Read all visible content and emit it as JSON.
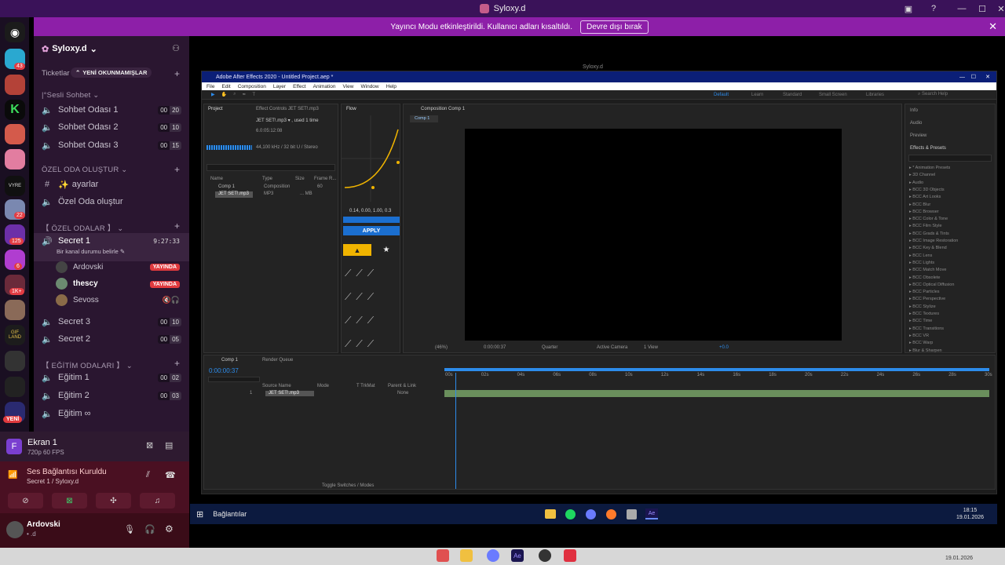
{
  "window": {
    "title": "Syloxy.d"
  },
  "notice": {
    "text": "Yayıncı Modu etkinleştirildi. Kullanıcı adları kısaltıldı.",
    "button": "Devre dışı bırak"
  },
  "rail": {
    "badges": [
      "43",
      "22",
      "125",
      "6",
      "1K+",
      "1"
    ],
    "new_label": "YENİ",
    "gif_label": "GIF LAND"
  },
  "server": {
    "name": "Syloxy.d",
    "chevron": "⌄"
  },
  "channels": {
    "ticketlar": "Ticketlar",
    "new_unread": "YENİ OKUNMAMIŞLAR",
    "cat_voice": "|°Sesli Sohbet",
    "voice": [
      {
        "name": "Sohbet Odası 1",
        "a": "00",
        "b": "20"
      },
      {
        "name": "Sohbet Odası 2",
        "a": "00",
        "b": "10"
      },
      {
        "name": "Sohbet Odası 3",
        "a": "00",
        "b": "15"
      }
    ],
    "cat_private_create": "ÖZEL ODA OLUŞTUR",
    "settings": "ayarlar",
    "create_room": "Özel Oda oluştur",
    "cat_private_rooms": "【 ÖZEL ODALAR 】",
    "secret1": "Secret 1",
    "secret1_time": "9:27:33",
    "status_prompt": "Bir kanal durumu belirle",
    "users": [
      {
        "name": "Ardovski",
        "badge": "YAYINDA"
      },
      {
        "name": "thescy",
        "badge": "YAYINDA"
      },
      {
        "name": "Sevoss",
        "badge": ""
      }
    ],
    "secret3": {
      "name": "Secret 3",
      "a": "00",
      "b": "10"
    },
    "secret2": {
      "name": "Secret 2",
      "a": "00",
      "b": "05"
    },
    "cat_education": "【 EĞİTİM ODALARI 】",
    "edu": [
      {
        "name": "Eğitim 1",
        "a": "00",
        "b": "02"
      },
      {
        "name": "Eğitim 2",
        "a": "00",
        "b": "03"
      },
      {
        "name": "Eğitim ∞",
        "a": "",
        "b": ""
      }
    ]
  },
  "stream": {
    "title": "Ekran 1",
    "sub": "720p 60 FPS"
  },
  "voice_status": {
    "title": "Ses Bağlantısı Kuruldu",
    "sub": "Secret 1 / Syloxy.d"
  },
  "self": {
    "name": "Ardovski",
    "status": "• .d"
  },
  "shared": {
    "owner": "Syloxy.d"
  },
  "ae": {
    "title": "Adobe After Effects 2020 - Untitled Project.aep *",
    "menu": [
      "File",
      "Edit",
      "Composition",
      "Layer",
      "Effect",
      "Animation",
      "View",
      "Window",
      "Help"
    ],
    "workspaces": [
      "Default",
      "Learn",
      "Standard",
      "Small Screen",
      "Libraries"
    ],
    "search": "Search Help",
    "project_tab": "Project",
    "effect_controls": "Effect Controls JET SET!.mp3",
    "file_info": [
      "JET SET!.mp3 ▾ , used 1 time",
      "6.0:05:12:08",
      "44,100 kHz / 32 bit U / Stereo"
    ],
    "project_cols": [
      "Name",
      "Type",
      "Size",
      "Frame R..."
    ],
    "project_rows": [
      {
        "name": "Comp 1",
        "type": "Composition",
        "size": "",
        "fr": "60"
      },
      {
        "name": "JET SET!.mp3",
        "type": "MP3",
        "size": "... MB",
        "fr": ""
      }
    ],
    "flow_tab": "Flow",
    "apply": "APPLY",
    "flow_values": "0.14, 0.00, 1.00, 0.3",
    "comp_tab": "Composition Comp 1",
    "comp_sub": "Comp 1",
    "viewer": [
      "(46%)",
      "0:00:00:37",
      "Quarter",
      "Active Camera",
      "1 View",
      "+0.0"
    ],
    "right_panels": [
      "Info",
      "Audio",
      "Preview",
      "Effects & Presets"
    ],
    "fx_list": [
      "* Animation Presets",
      "3D Channel",
      "Audio",
      "BCC 3D Objects",
      "BCC Art Looks",
      "BCC Blur",
      "BCC Browser",
      "BCC Color & Tone",
      "BCC Film Style",
      "BCC Grads & Tints",
      "BCC Image Restoration",
      "BCC Key & Blend",
      "BCC Lens",
      "BCC Lights",
      "BCC Match Move",
      "BCC Obsolete",
      "BCC Optical Diffusion",
      "BCC Particles",
      "BCC Perspective",
      "BCC Stylize",
      "BCC Textures",
      "BCC Time",
      "BCC Transitions",
      "BCC VR",
      "BCC Warp",
      "Blur & Sharpen"
    ],
    "timeline_tabs": [
      "Comp 1",
      "Render Queue"
    ],
    "timecode": "0:00:00:37",
    "layer_cols": [
      "Source Name",
      "Mode",
      "T TrkMat",
      "Parent & Link"
    ],
    "layer": {
      "num": "1",
      "name": "JET SET!.mp3",
      "parent": "None"
    },
    "ruler": [
      "00s",
      "02s",
      "04s",
      "06s",
      "08s",
      "10s",
      "12s",
      "14s",
      "16s",
      "18s",
      "20s",
      "22s",
      "24s",
      "26s",
      "28s",
      "30s"
    ],
    "toggle": "Toggle Switches / Modes"
  },
  "win_taskbar": {
    "label": "Bağlantılar",
    "time": "18:15",
    "date": "19.01.2026"
  },
  "host_taskbar": {
    "date": "19.01.2026"
  },
  "colors": {
    "accent": "#8d1fa8",
    "live": "#e03a3e",
    "ae_blue": "#2d8ceb",
    "apply_blue": "#1b6fd0",
    "flow_yellow": "#f0b400"
  }
}
